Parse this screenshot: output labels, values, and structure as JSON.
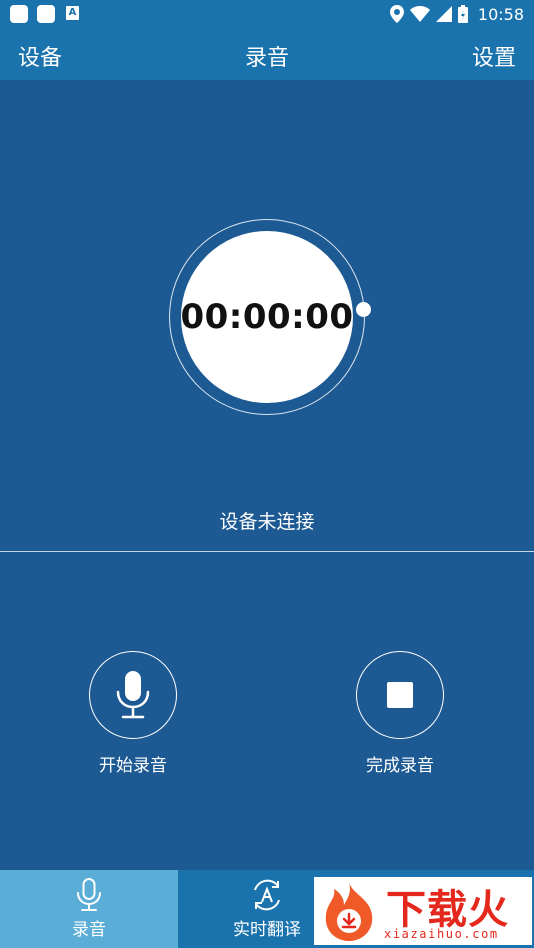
{
  "status_bar": {
    "time": "10:58",
    "badge_letter": "A"
  },
  "toolbar": {
    "left_label": "设备",
    "title": "录音",
    "right_label": "设置"
  },
  "timer": {
    "value": "00:00:00"
  },
  "device_status": "设备未连接",
  "controls": {
    "start_label": "开始录音",
    "finish_label": "完成录音"
  },
  "bottom_nav": {
    "items": [
      {
        "label": "录音",
        "icon": "mic-icon",
        "active": true
      },
      {
        "label": "实时翻译",
        "icon": "translate-icon",
        "active": false
      }
    ]
  },
  "watermark": {
    "title": "下载火",
    "url": "xiazaihuo.com"
  },
  "colors": {
    "background": "#1d5a93",
    "bar": "#1a73ad",
    "active_tab": "#5aadd6",
    "watermark_red": "#e5281d"
  }
}
